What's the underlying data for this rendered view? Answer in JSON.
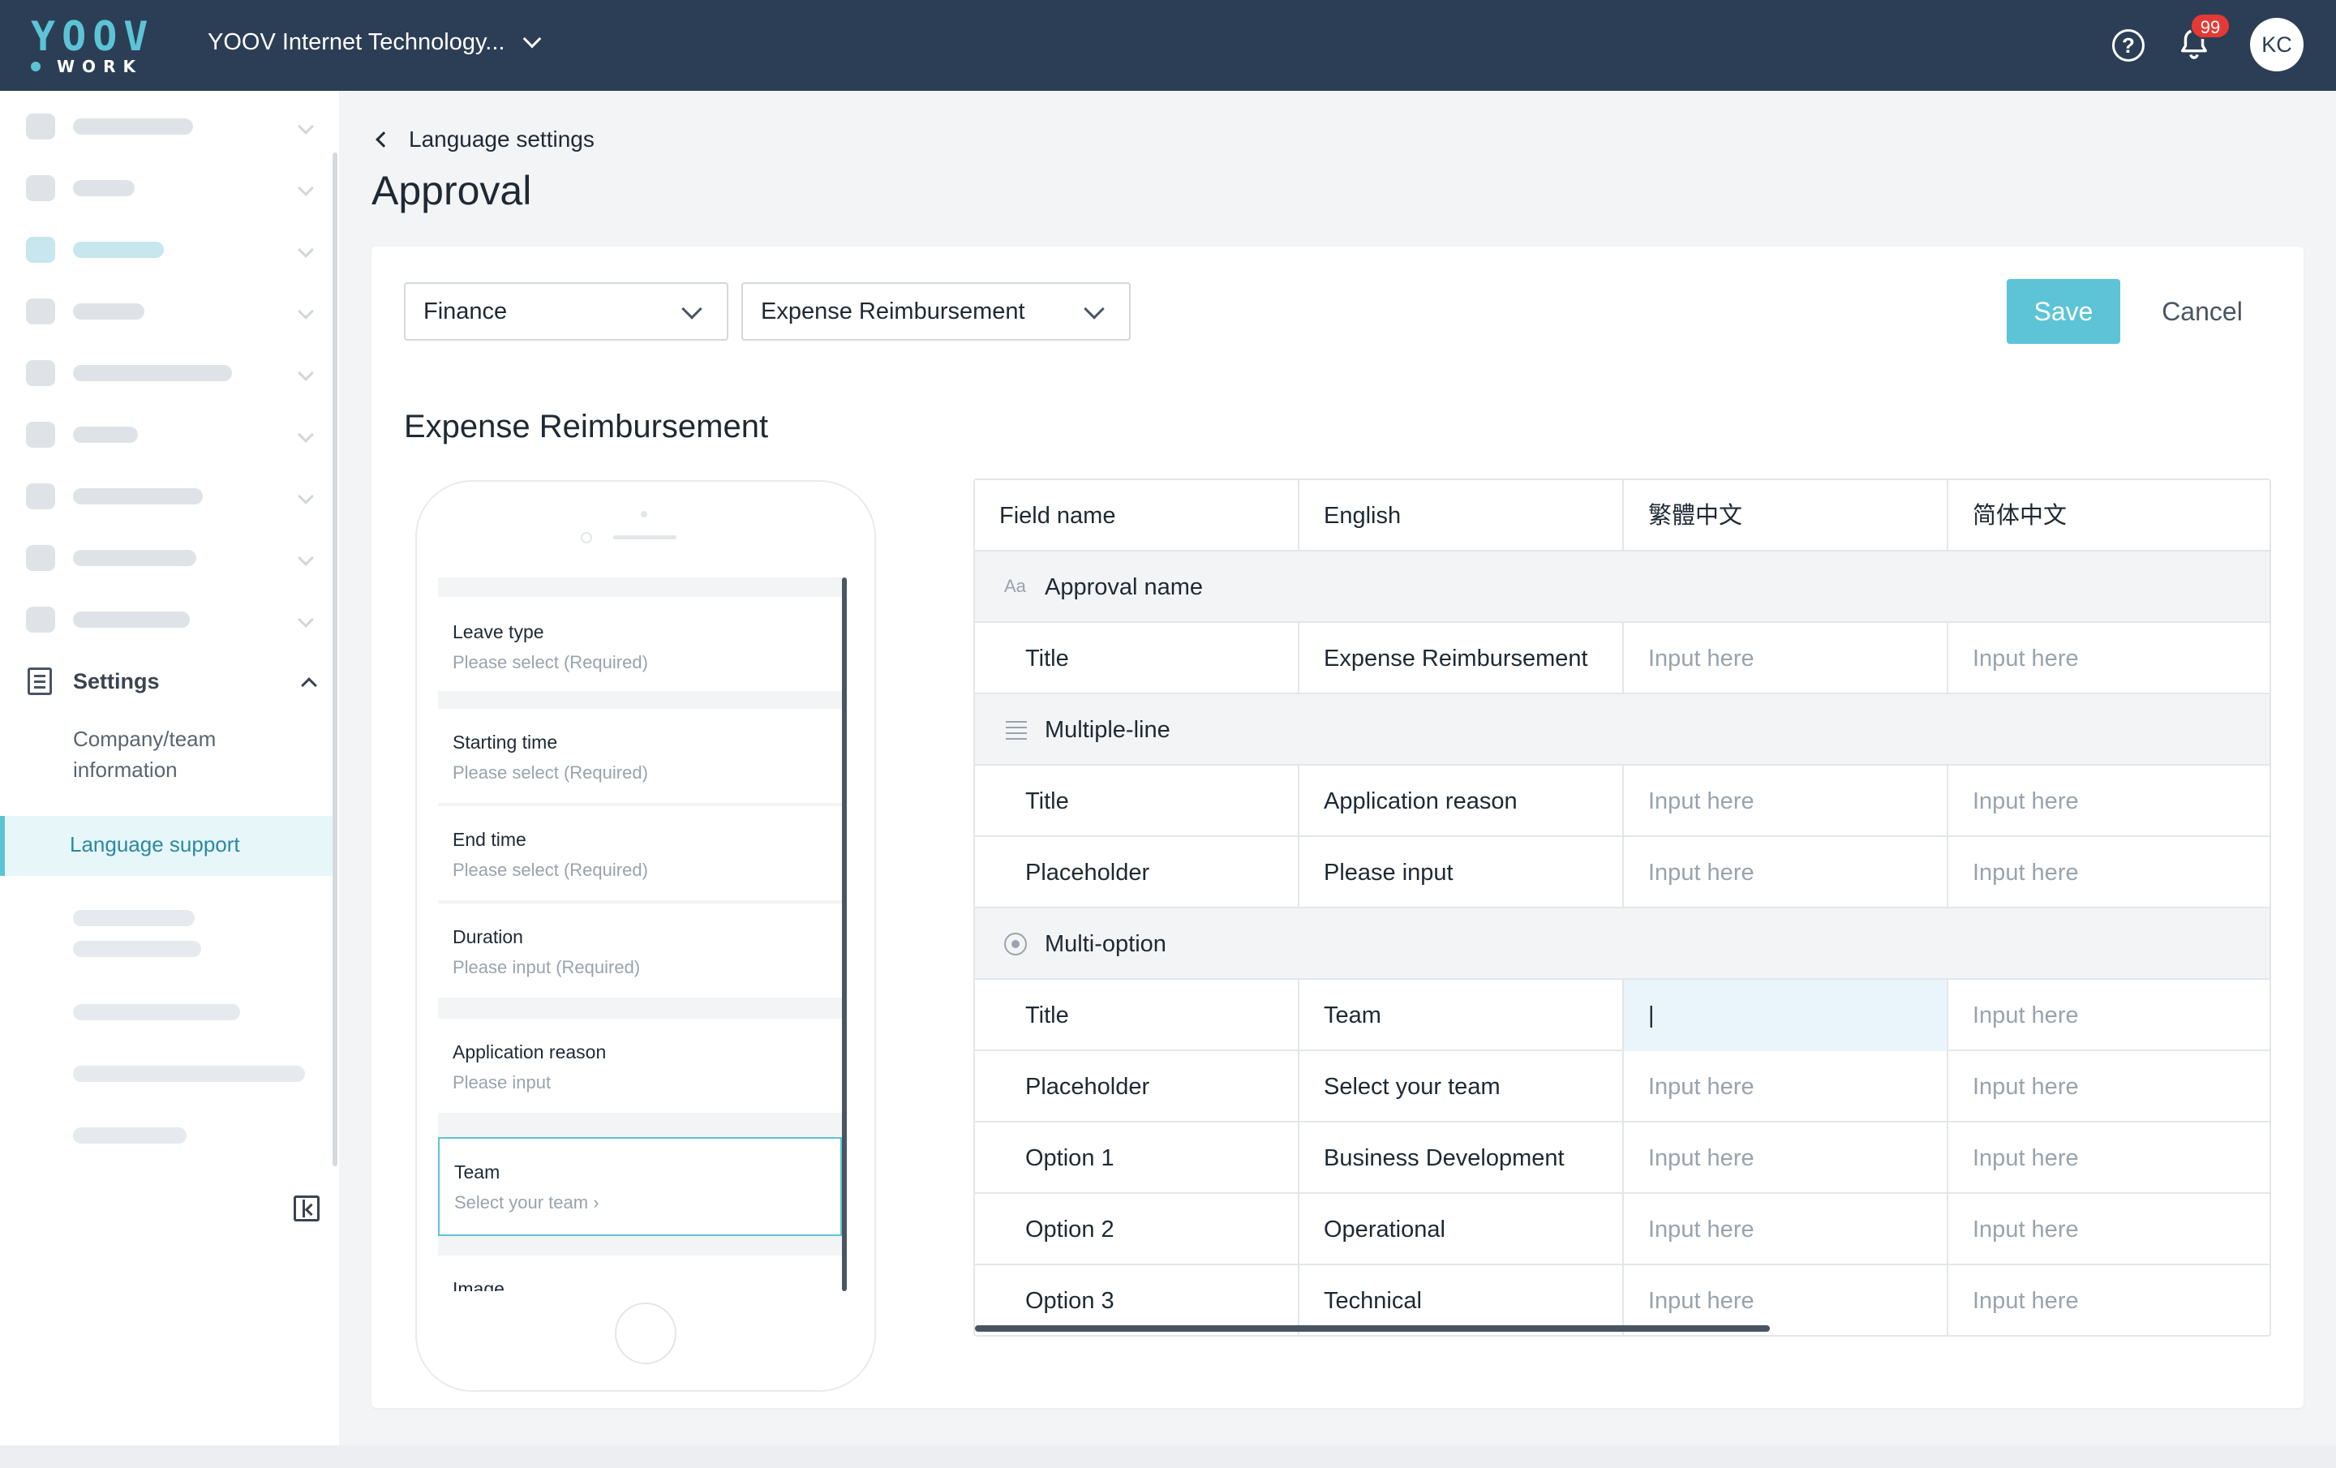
{
  "topbar": {
    "logo_text": "YOOV",
    "logo_sub": "WORK",
    "org_name": "YOOV Internet Technology...",
    "help_icon": "question-circle-icon",
    "bell_icon": "bell-icon",
    "notification_count": "99",
    "avatar_initials": "KC",
    "colors": {
      "bar": "#2c3e55",
      "accent": "#5cc4d6",
      "badge": "#e53935"
    }
  },
  "sidebar": {
    "settings_label": "Settings",
    "sub_items": [
      {
        "label": "Company/team information"
      },
      {
        "label": "Language support",
        "active": true
      }
    ]
  },
  "header": {
    "back_label": "Language settings",
    "title": "Approval"
  },
  "toolbar": {
    "category_select": "Finance",
    "form_select": "Expense Reimbursement",
    "save_label": "Save",
    "cancel_label": "Cancel"
  },
  "section_title": "Expense Reimbursement",
  "phone_preview": {
    "fields": [
      {
        "label": "Leave type",
        "placeholder": "Please select (Required)"
      },
      {
        "label": "Starting time",
        "placeholder": "Please select (Required)"
      },
      {
        "label": "End time",
        "placeholder": "Please select (Required)"
      },
      {
        "label": "Duration",
        "placeholder": "Please input (Required)"
      },
      {
        "label": "Application reason",
        "placeholder": "Please input"
      },
      {
        "label": "Team",
        "placeholder": "Select your team ›",
        "selected": true
      },
      {
        "label": "Image",
        "placeholder": ""
      }
    ]
  },
  "table": {
    "headers": [
      "Field name",
      "English",
      "繁體中文",
      "简体中文"
    ],
    "input_placeholder": "Input here",
    "groups": [
      {
        "icon": "text-aa-icon",
        "icon_glyph": "Aa",
        "name": "Approval name",
        "rows": [
          {
            "field": "Title",
            "english": "Expense Reimbursement"
          }
        ]
      },
      {
        "icon": "multiline-text-icon",
        "name": "Multiple-line",
        "rows": [
          {
            "field": "Title",
            "english": "Application reason"
          },
          {
            "field": "Placeholder",
            "english": "Please input"
          }
        ]
      },
      {
        "icon": "radio-option-icon",
        "name": "Multi-option",
        "rows": [
          {
            "field": "Title",
            "english": "Team",
            "tc_value": "|"
          },
          {
            "field": "Placeholder",
            "english": "Select your team"
          },
          {
            "field": "Option 1",
            "english": "Business Development"
          },
          {
            "field": "Option 2",
            "english": "Operational"
          },
          {
            "field": "Option 3",
            "english": "Technical"
          }
        ]
      }
    ]
  }
}
